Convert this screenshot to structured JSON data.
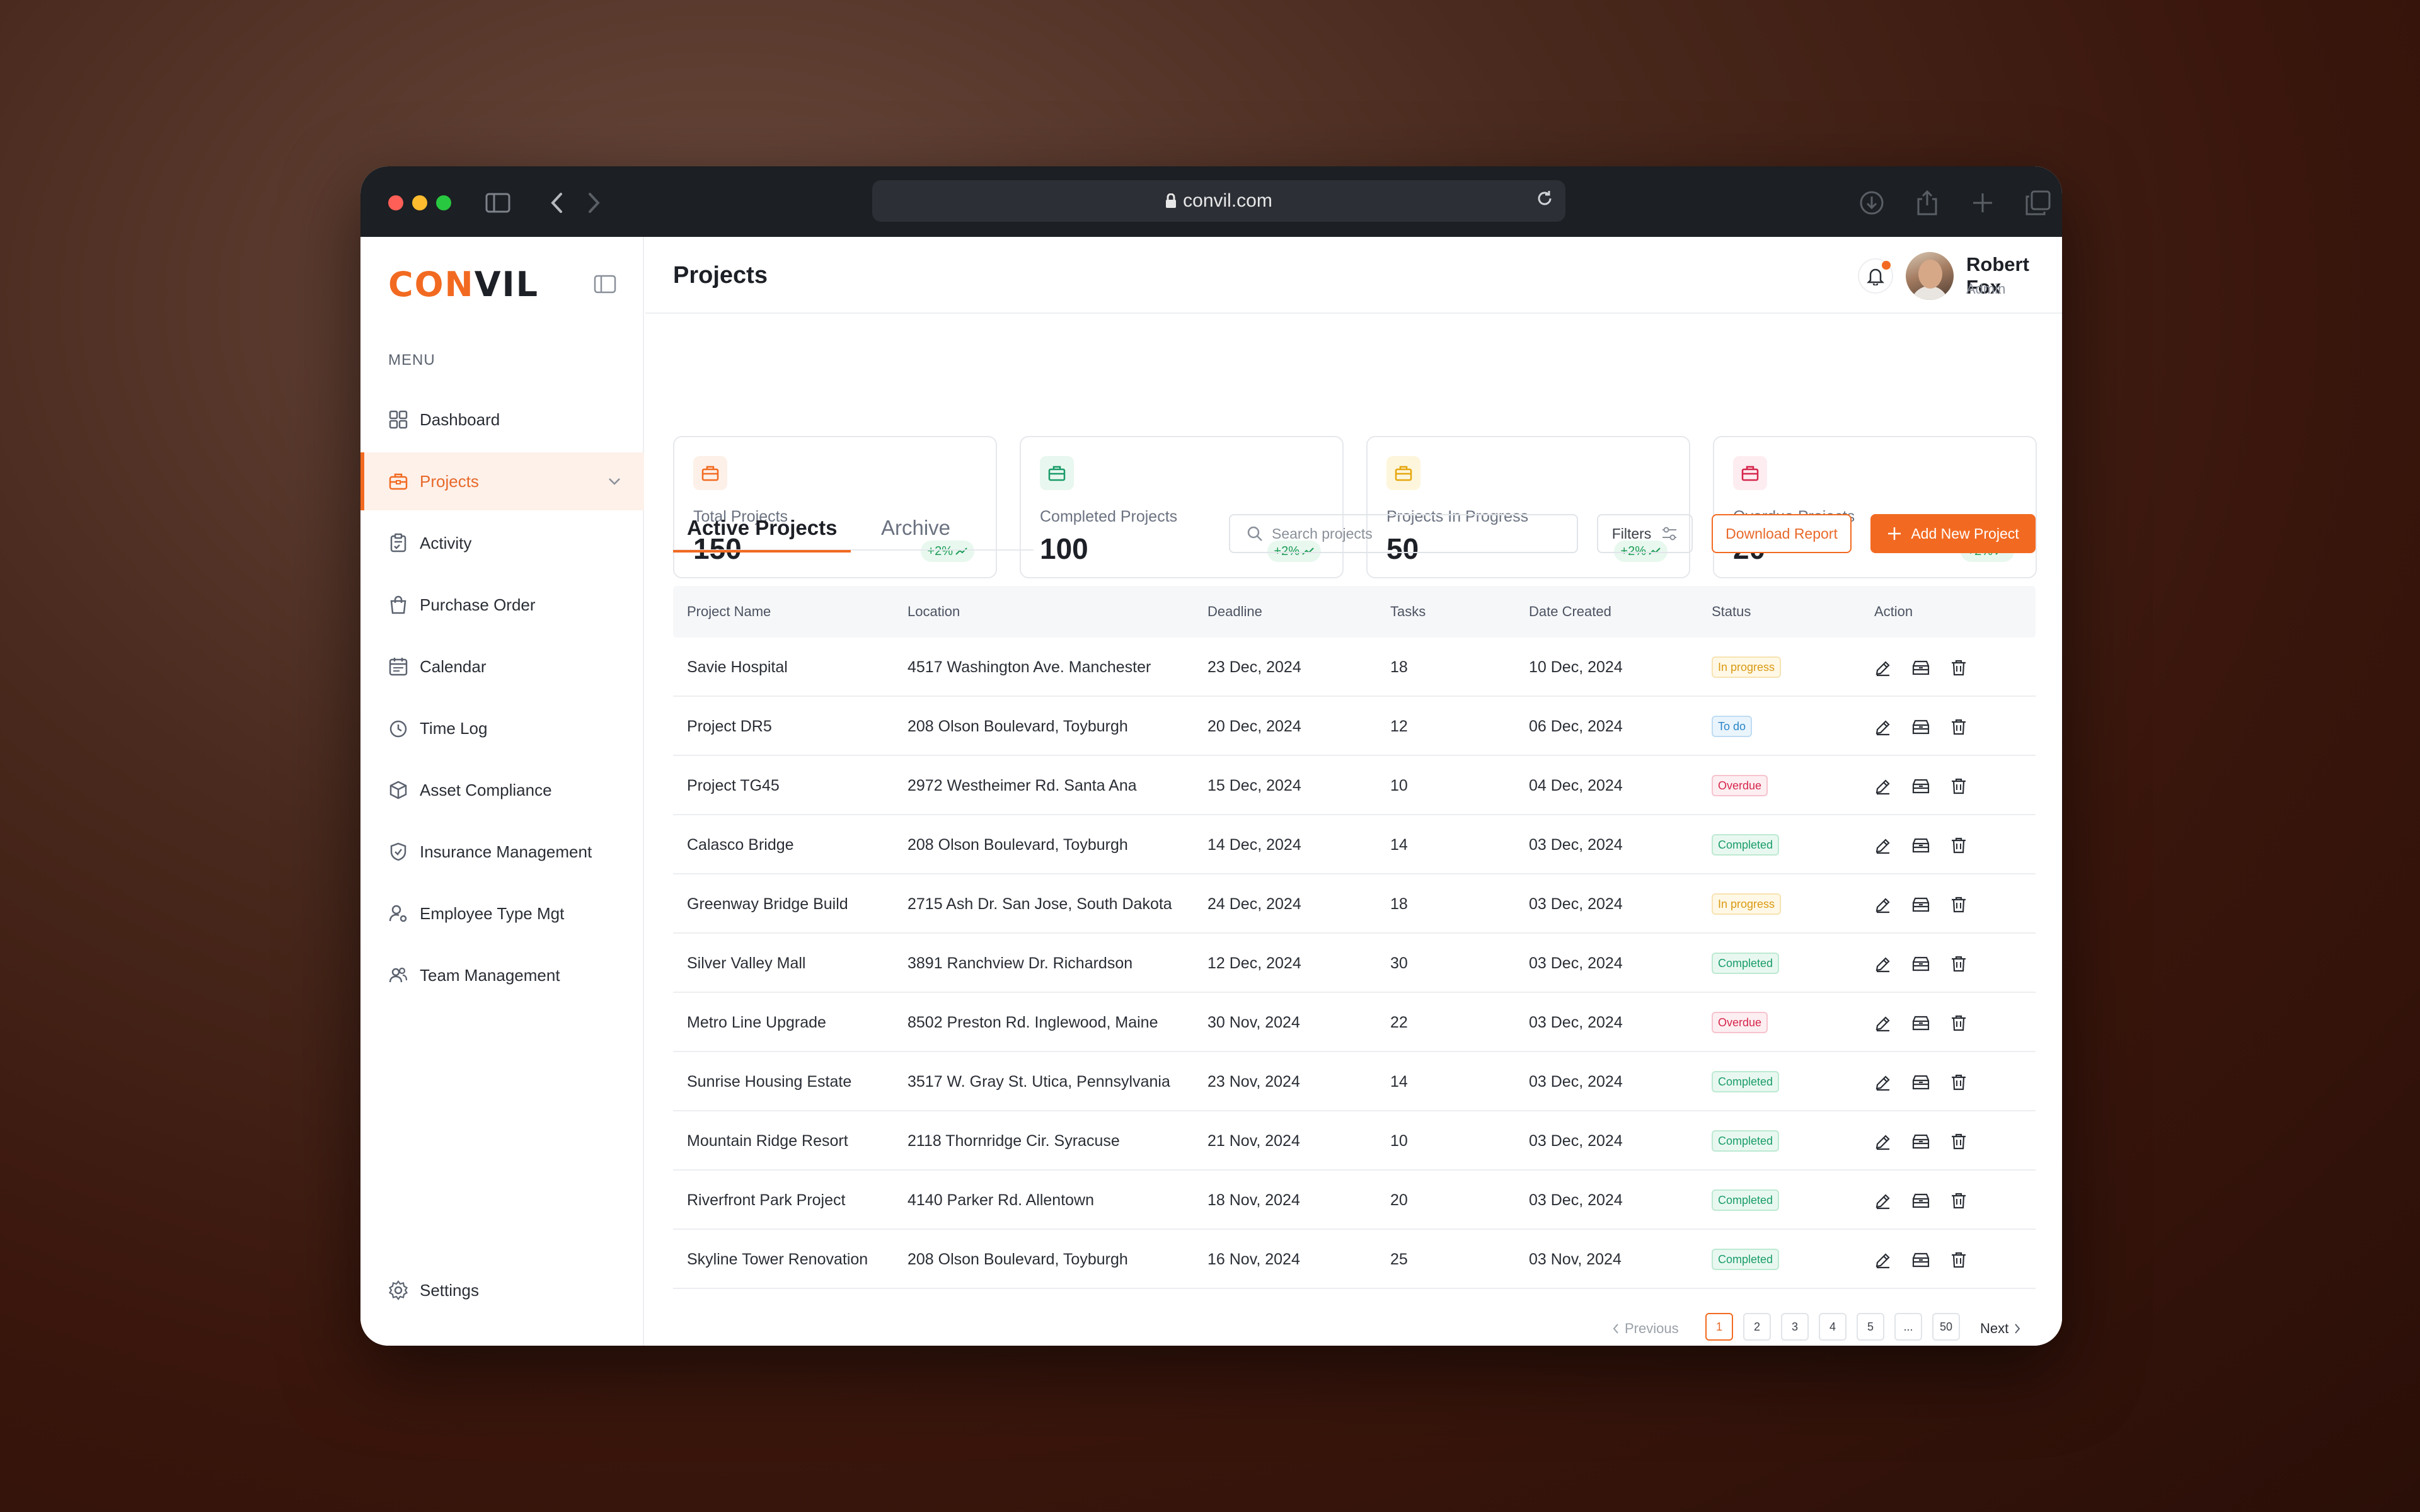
{
  "browser": {
    "url": "convil.com"
  },
  "sidebar": {
    "logo_part1": "CON",
    "logo_part2": "VIL",
    "menu_label": "MENU",
    "items": [
      {
        "label": "Dashboard",
        "icon": "grid-icon"
      },
      {
        "label": "Projects",
        "icon": "briefcase-icon",
        "active": true
      },
      {
        "label": "Activity",
        "icon": "clipboard-icon"
      },
      {
        "label": "Purchase Order",
        "icon": "shopping-bag-icon"
      },
      {
        "label": "Calendar",
        "icon": "calendar-icon"
      },
      {
        "label": "Time Log",
        "icon": "timer-icon"
      },
      {
        "label": "Asset Compliance",
        "icon": "box-icon"
      },
      {
        "label": "Insurance Management",
        "icon": "shield-check-icon"
      },
      {
        "label": "Employee Type Mgt",
        "icon": "user-gear-icon"
      },
      {
        "label": "Team Management",
        "icon": "users-icon"
      }
    ],
    "settings_label": "Settings"
  },
  "header": {
    "title": "Projects",
    "user_name": "Robert Fox",
    "user_role": "Admin"
  },
  "stats": [
    {
      "label": "Total Projects",
      "value": "150",
      "trend": "+2%",
      "color": "#f26a21",
      "bg": "#fdf0e8"
    },
    {
      "label": "Completed Projects",
      "value": "100",
      "trend": "+2%",
      "color": "#1a9c6a",
      "bg": "#e8f7ef"
    },
    {
      "label": "Projects In Progress",
      "value": "50",
      "trend": "+2%",
      "color": "#e6a70f",
      "bg": "#fdf6dc"
    },
    {
      "label": "Overdue Projects",
      "value": "20",
      "trend": "+2%",
      "color": "#d6264c",
      "bg": "#fdecf0"
    }
  ],
  "tabs": {
    "active": "Active Projects",
    "archive": "Archive"
  },
  "toolbar": {
    "search_placeholder": "Search projects",
    "filters_label": "Filters",
    "download_label": "Download Report",
    "add_label": "Add New Project"
  },
  "table": {
    "columns": [
      "Project Name",
      "Location",
      "Deadline",
      "Tasks",
      "Date Created",
      "Status",
      "Action"
    ],
    "rows": [
      {
        "name": "Savie Hospital",
        "location": "4517 Washington Ave. Manchester",
        "deadline": "23 Dec, 2024",
        "tasks": "18",
        "created": "10 Dec, 2024",
        "status": "In progress",
        "status_class": "st-progress"
      },
      {
        "name": "Project DR5",
        "location": "208 Olson Boulevard, Toyburgh",
        "deadline": "20 Dec, 2024",
        "tasks": "12",
        "created": "06 Dec, 2024",
        "status": "To do",
        "status_class": "st-todo"
      },
      {
        "name": "Project TG45",
        "location": "2972 Westheimer Rd. Santa Ana",
        "deadline": "15 Dec, 2024",
        "tasks": "10",
        "created": "04 Dec, 2024",
        "status": "Overdue",
        "status_class": "st-overdue"
      },
      {
        "name": "Calasco Bridge",
        "location": "208 Olson Boulevard, Toyburgh",
        "deadline": "14 Dec, 2024",
        "tasks": "14",
        "created": "03 Dec, 2024",
        "status": "Completed",
        "status_class": "st-completed"
      },
      {
        "name": "Greenway Bridge Build",
        "location": "2715 Ash Dr. San Jose, South Dakota",
        "deadline": "24 Dec, 2024",
        "tasks": "18",
        "created": "03 Dec, 2024",
        "status": "In progress",
        "status_class": "st-progress"
      },
      {
        "name": "Silver Valley Mall",
        "location": "3891 Ranchview Dr. Richardson",
        "deadline": "12 Dec, 2024",
        "tasks": "30",
        "created": "03 Dec, 2024",
        "status": "Completed",
        "status_class": "st-completed"
      },
      {
        "name": "Metro Line Upgrade",
        "location": "8502 Preston Rd. Inglewood, Maine",
        "deadline": "30 Nov, 2024",
        "tasks": "22",
        "created": "03 Dec, 2024",
        "status": "Overdue",
        "status_class": "st-overdue"
      },
      {
        "name": "Sunrise Housing Estate",
        "location": "3517 W. Gray St. Utica, Pennsylvania",
        "deadline": "23 Nov, 2024",
        "tasks": "14",
        "created": "03 Dec, 2024",
        "status": "Completed",
        "status_class": "st-completed"
      },
      {
        "name": "Mountain Ridge Resort",
        "location": "2118 Thornridge Cir. Syracuse",
        "deadline": "21 Nov, 2024",
        "tasks": "10",
        "created": "03 Dec, 2024",
        "status": "Completed",
        "status_class": "st-completed"
      },
      {
        "name": "Riverfront Park Project",
        "location": "4140 Parker Rd. Allentown",
        "deadline": "18 Nov, 2024",
        "tasks": "20",
        "created": "03 Dec, 2024",
        "status": "Completed",
        "status_class": "st-completed"
      },
      {
        "name": "Skyline Tower Renovation",
        "location": "208 Olson Boulevard, Toyburgh",
        "deadline": "16 Nov, 2024",
        "tasks": "25",
        "created": "03 Nov, 2024",
        "status": "Completed",
        "status_class": "st-completed"
      }
    ]
  },
  "pagination": {
    "previous": "Previous",
    "next": "Next",
    "pages": [
      "1",
      "2",
      "3",
      "4",
      "5",
      "...",
      "50"
    ],
    "current": "1"
  },
  "colors": {
    "accent": "#f26a21",
    "text": "#1d2026"
  }
}
